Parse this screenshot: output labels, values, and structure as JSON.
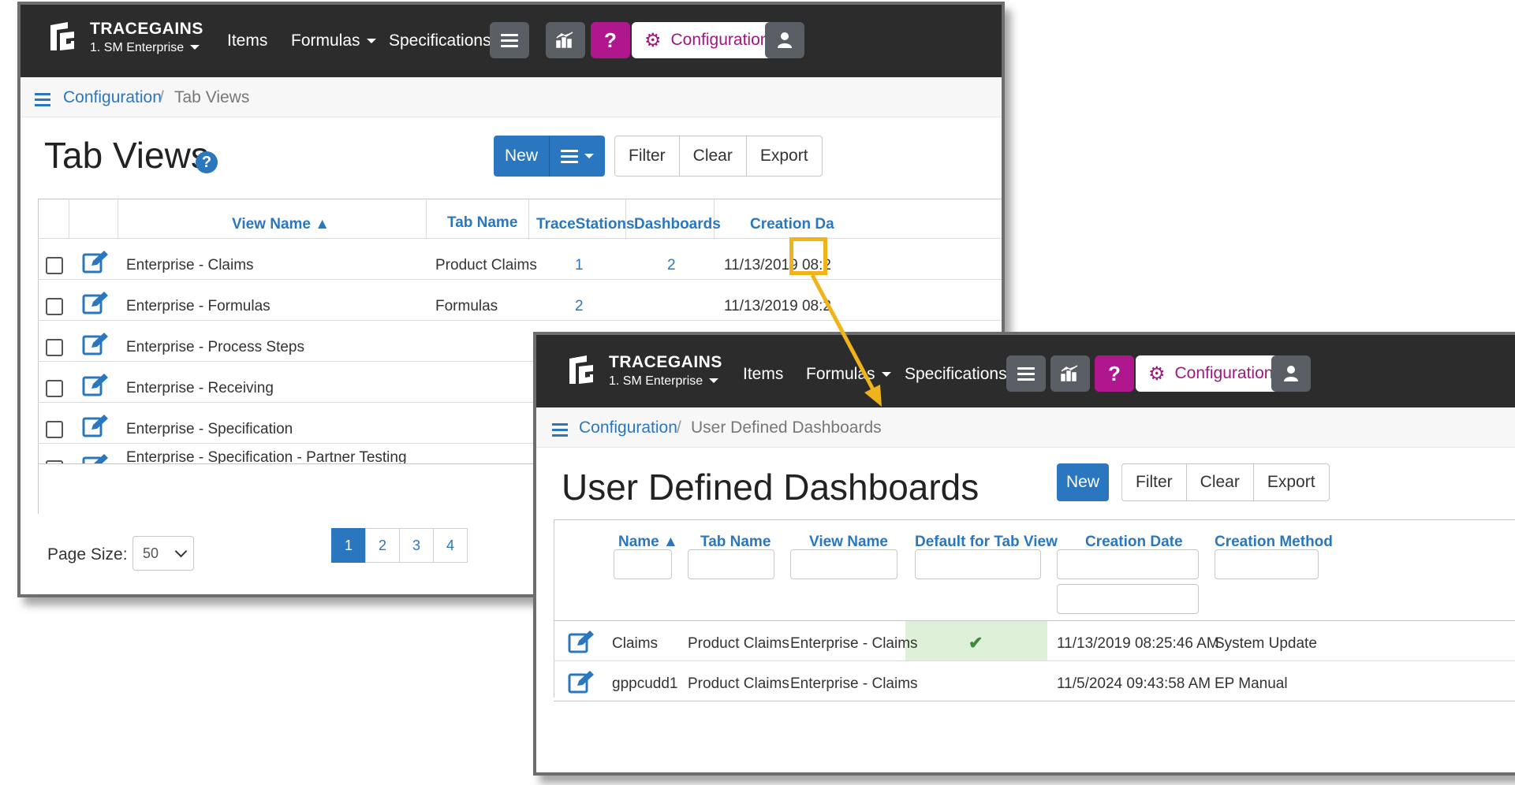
{
  "app": {
    "brand": "TRACEGAINS",
    "org": "1. SM Enterprise",
    "nav": {
      "items": "Items",
      "formulas": "Formulas",
      "specifications": "Specifications",
      "configuration": "Configuration",
      "help": "?"
    }
  },
  "tab_views": {
    "breadcrumb": {
      "parent": "Configuration",
      "sep": "/",
      "current": "Tab Views"
    },
    "title": "Tab Views",
    "help_icon": "?",
    "buttons": {
      "new": "New",
      "filter": "Filter",
      "clear": "Clear",
      "export": "Export"
    },
    "columns": [
      "View Name ▲",
      "Tab Name",
      "TraceStations",
      "Dashboards",
      "Creation Da"
    ],
    "rows": [
      {
        "view_name": "Enterprise - Claims",
        "tab_name": "Product Claims",
        "tracestations": "1",
        "dashboards": "2",
        "created": "11/13/2019 08:2"
      },
      {
        "view_name": "Enterprise - Formulas",
        "tab_name": "Formulas",
        "tracestations": "2",
        "dashboards": "",
        "created": "11/13/2019 08:2"
      },
      {
        "view_name": "Enterprise - Process Steps",
        "tab_name": "",
        "tracestations": "",
        "dashboards": "",
        "created": ""
      },
      {
        "view_name": "Enterprise - Receiving",
        "tab_name": "",
        "tracestations": "",
        "dashboards": "",
        "created": ""
      },
      {
        "view_name": "Enterprise - Specification",
        "tab_name": "",
        "tracestations": "",
        "dashboards": "",
        "created": ""
      },
      {
        "view_name": "Enterprise - Specification - Partner Testing",
        "tab_name": "",
        "tracestations": "",
        "dashboards": "",
        "created": ""
      }
    ],
    "page_size_label": "Page Size:",
    "page_size": "50",
    "pages": [
      "1",
      "2",
      "3",
      "4"
    ],
    "active_page": "1"
  },
  "dashboards": {
    "breadcrumb": {
      "parent": "Configuration",
      "sep": "/",
      "current": "User Defined Dashboards"
    },
    "title": "User Defined Dashboards",
    "buttons": {
      "new": "New",
      "filter": "Filter",
      "clear": "Clear",
      "export": "Export"
    },
    "columns": [
      "Name ▲",
      "Tab Name",
      "View Name",
      "Default for Tab View",
      "Creation Date",
      "Creation Method"
    ],
    "rows": [
      {
        "name": "Claims",
        "tab_name": "Product Claims",
        "view_name": "Enterprise - Claims",
        "default": "✔",
        "created": "11/13/2019 08:25:46 AM",
        "method": "System Update"
      },
      {
        "name": "gppcudd1",
        "tab_name": "Product Claims",
        "view_name": "Enterprise - Claims",
        "default": "",
        "created": "11/5/2024 09:43:58 AM",
        "method": "EP Manual"
      }
    ]
  },
  "colors": {
    "topbar": "#2c2c2c",
    "link": "#2a77c0",
    "help": "#b0178f",
    "highlight": "#f0b41a",
    "default_cell": "#dff0d8",
    "check": "#3c8a3c"
  }
}
